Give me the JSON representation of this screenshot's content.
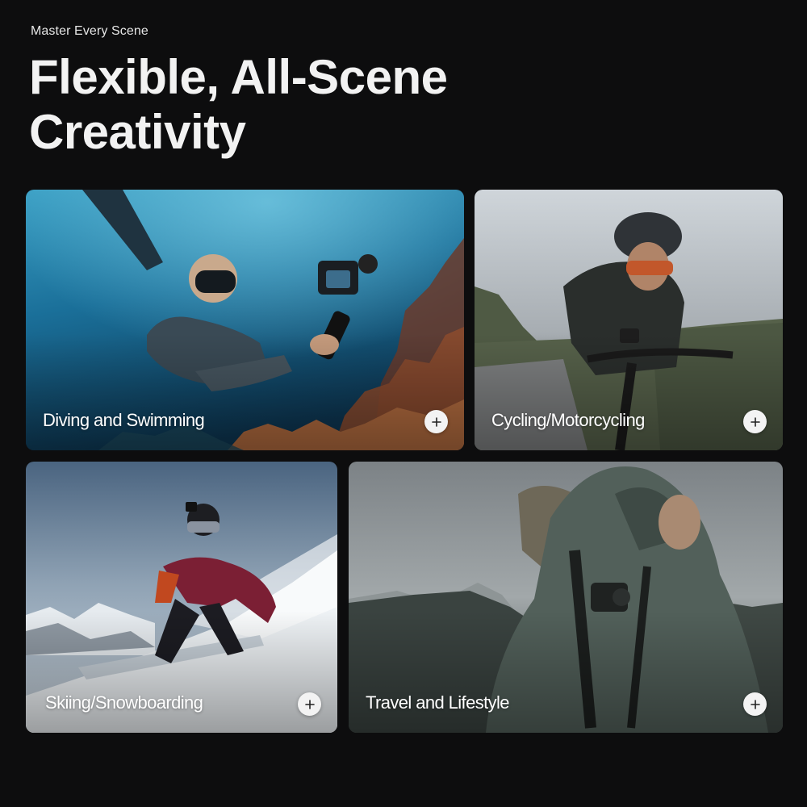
{
  "header": {
    "eyebrow": "Master Every Scene",
    "title_line1": "Flexible, All-Scene",
    "title_line2": "Creativity"
  },
  "cards": [
    {
      "label": "Diving and Swimming",
      "icon": "plus-icon"
    },
    {
      "label": "Cycling/Motorcycling",
      "icon": "plus-icon"
    },
    {
      "label": "Skiing/Snowboarding",
      "icon": "plus-icon"
    },
    {
      "label": "Travel and Lifestyle",
      "icon": "plus-icon"
    }
  ],
  "colors": {
    "background": "#0d0d0e",
    "text": "#ffffff",
    "button_bg": "#f3f3f3",
    "button_icon": "#222222"
  }
}
